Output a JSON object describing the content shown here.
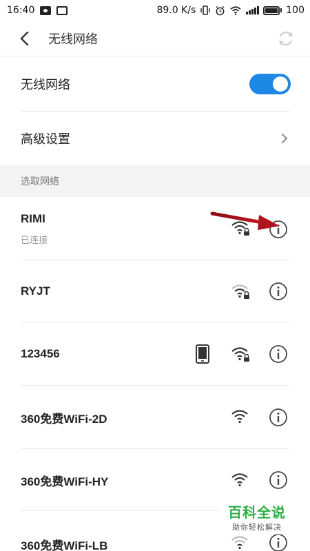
{
  "status_bar": {
    "time": "16:40",
    "speed": "89.0 K/s",
    "battery": "100"
  },
  "header": {
    "title": "无线网络"
  },
  "settings": {
    "wifi_label": "无线网络",
    "wifi_enabled": true,
    "advanced_label": "高级设置"
  },
  "section": {
    "choose_network": "选取网络"
  },
  "networks": [
    {
      "name": "RIMI",
      "status": "已连接",
      "locked": true,
      "hotspot": false
    },
    {
      "name": "RYJT",
      "status": "",
      "locked": true,
      "hotspot": false
    },
    {
      "name": "123456",
      "status": "",
      "locked": true,
      "hotspot": true
    },
    {
      "name": "360免费WiFi-2D",
      "status": "",
      "locked": false,
      "hotspot": false
    },
    {
      "name": "360免费WiFi-HY",
      "status": "",
      "locked": false,
      "hotspot": false
    },
    {
      "name": "360免费WiFi-LB",
      "status": "",
      "locked": false,
      "hotspot": false
    }
  ],
  "watermark": {
    "title": "百科全说",
    "subtitle": "助你轻松解决"
  },
  "colors": {
    "accent": "#1e88e5",
    "arrow": "#b0121e",
    "watermark_green": "#2fae45"
  }
}
